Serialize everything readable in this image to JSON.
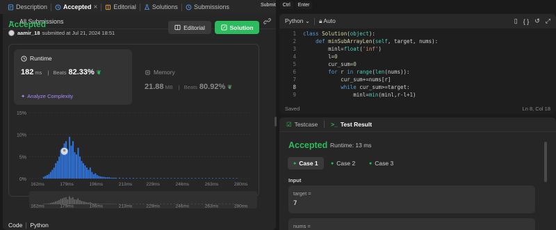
{
  "tabs": [
    {
      "label": "Description",
      "icon": "description-icon"
    },
    {
      "label": "Accepted",
      "icon": "history-icon",
      "close": "×"
    },
    {
      "label": "Editorial",
      "icon": "book-icon"
    },
    {
      "label": "Solutions",
      "icon": "flask-icon"
    },
    {
      "label": "Submissions",
      "icon": "history-icon"
    }
  ],
  "shortcut": {
    "submit": "Submit",
    "ctrl": "Ctrl",
    "enter": "Enter"
  },
  "left": {
    "back_label": "All Submissions",
    "status": "Accepted",
    "user": "aamir_18",
    "submitted": "submitted at Jul 21, 2024 18:51",
    "editorial_btn": "Editorial",
    "solution_btn": "Solution",
    "runtime": {
      "label": "Runtime",
      "value": "182",
      "unit": "ms",
      "beats_label": "Beats",
      "beats": "82.33%"
    },
    "analyze": "Analyze Complexity",
    "memory": {
      "label": "Memory",
      "value": "21.88",
      "unit": "MB",
      "beats_label": "Beats",
      "beats": "80.92%"
    },
    "code_label": "Code",
    "code_lang": "Python"
  },
  "chart_data": {
    "type": "bar",
    "y_ticks": [
      "15%",
      "10%",
      "5%",
      "0%"
    ],
    "ylim": [
      0,
      15
    ],
    "x_ticks": [
      "162ms",
      "179ms",
      "196ms",
      "213ms",
      "229ms",
      "246ms",
      "263ms",
      "280ms"
    ],
    "x_range": [
      162,
      287
    ],
    "bars_x": [
      170,
      171,
      172,
      173,
      174,
      175,
      176,
      177,
      178,
      179,
      180,
      181,
      182,
      183,
      184,
      185,
      186,
      187,
      188,
      189,
      190,
      191,
      192,
      193,
      194,
      195,
      196,
      197,
      198,
      199,
      200,
      201,
      202,
      203,
      204,
      205,
      206,
      207,
      208,
      209,
      210,
      211,
      212,
      214,
      216,
      218,
      220,
      222,
      224,
      226,
      228,
      230,
      232,
      234,
      236,
      238,
      240,
      242,
      244,
      246,
      248,
      250,
      252,
      254,
      256,
      258,
      260,
      262,
      264,
      266,
      268,
      270,
      272,
      274,
      276,
      278,
      280,
      282
    ],
    "bars_y": [
      0.4,
      0.6,
      0.8,
      1.0,
      1.5,
      2.0,
      2.5,
      3.5,
      4.0,
      5.0,
      6.5,
      7.0,
      8.0,
      8.5,
      6.0,
      9.5,
      7.5,
      8.5,
      6.0,
      5.5,
      7.0,
      5.0,
      4.0,
      3.5,
      3.0,
      2.5,
      2.0,
      2.5,
      1.5,
      1.0,
      1.2,
      0.8,
      0.6,
      0.5,
      0.4,
      0.4,
      0.3,
      0.3,
      0.3,
      0.2,
      0.2,
      0.2,
      0.2,
      0.2,
      0.15,
      0.15,
      0.15,
      0.15,
      0.1,
      0.1,
      0.1,
      0.1,
      0.1,
      0.1,
      0.1,
      0.1,
      0.1,
      0.1,
      0.1,
      0.1,
      0.1,
      0.1,
      0.1,
      0.1,
      0.1,
      0.1,
      0.1,
      0.1,
      0.1,
      0.1,
      0.1,
      0.1,
      0.1,
      0.1,
      0.1,
      0.1,
      0.1,
      0.1
    ],
    "highlight_x": 182,
    "colors": {
      "bar": "#2f73d9",
      "highlight": "#e8e8e8",
      "grid": "#3a3a3a",
      "axis_text": "#8a8a8a",
      "mini_bar": "#6a6a6a"
    }
  },
  "editor": {
    "language": "Python",
    "mode": "Auto",
    "lines": [
      {
        "n": "1",
        "t": "class Solution(object):"
      },
      {
        "n": "2",
        "t": "    def minSubArrayLen(self, target, nums):"
      },
      {
        "n": "3",
        "t": "        minl=float('inf')"
      },
      {
        "n": "4",
        "t": "        l=0"
      },
      {
        "n": "5",
        "t": "        cur_sum=0"
      },
      {
        "n": "6",
        "t": "        for r in range(len(nums)):"
      },
      {
        "n": "7",
        "t": "            cur_sum+=nums[r]"
      },
      {
        "n": "8",
        "t": "            while cur_sum>=target:"
      },
      {
        "n": "9",
        "t": "                minl=min(minl,r-l+1)"
      }
    ],
    "saved": "Saved",
    "cursor": "Ln 8, Col 18"
  },
  "test": {
    "testcase_tab": "Testcase",
    "result_tab": "Test Result",
    "status": "Accepted",
    "runtime": "Runtime: 13 ms",
    "cases": [
      "Case 1",
      "Case 2",
      "Case 3"
    ],
    "input_label": "Input",
    "params": [
      {
        "name": "target =",
        "value": "7"
      },
      {
        "name": "nums =",
        "value": ""
      }
    ]
  }
}
